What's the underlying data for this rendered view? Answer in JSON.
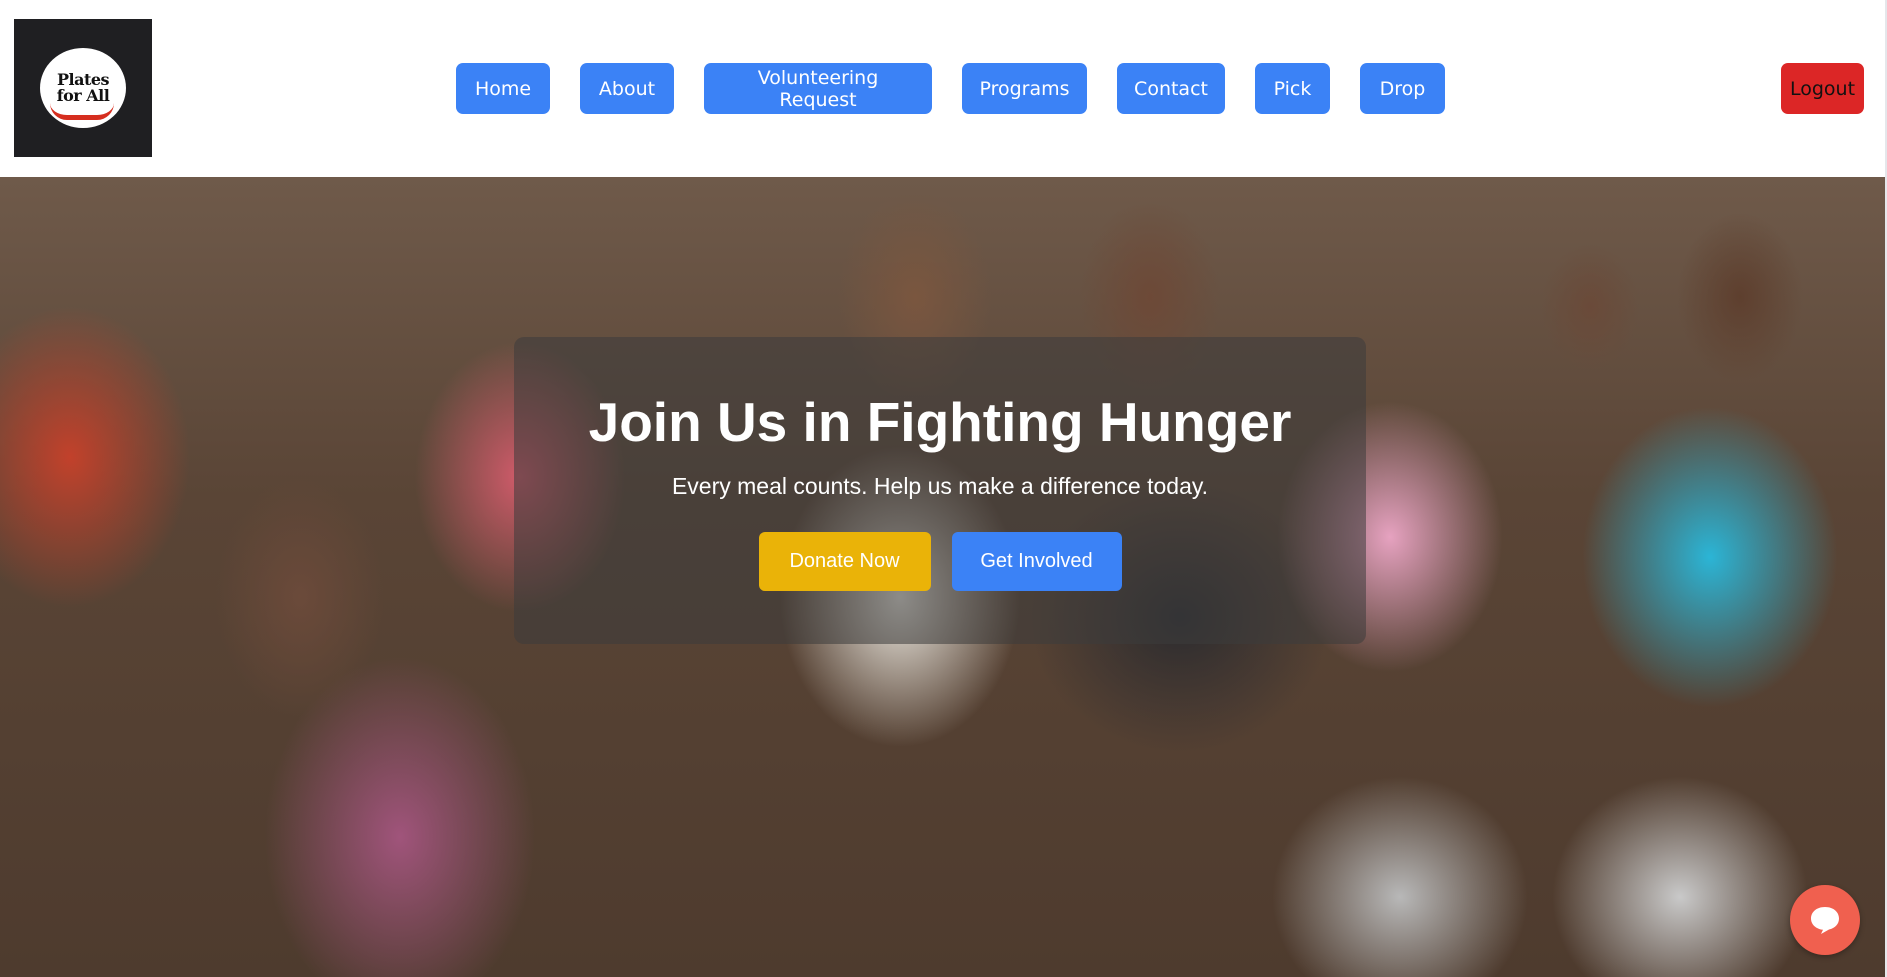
{
  "header": {
    "logo": {
      "line1": "Plates",
      "line2": "for All"
    },
    "nav": [
      {
        "label": "Home"
      },
      {
        "label": "About"
      },
      {
        "label": "Volunteering Request"
      },
      {
        "label": "Programs"
      },
      {
        "label": "Contact"
      },
      {
        "label": "Pick"
      },
      {
        "label": "Drop"
      }
    ],
    "logout_label": "Logout"
  },
  "hero": {
    "title": "Join Us in Fighting Hunger",
    "subtitle": "Every meal counts. Help us make a difference today.",
    "donate_label": "Donate Now",
    "involved_label": "Get Involved"
  },
  "chat": {
    "icon": "chat-bubble-icon"
  },
  "colors": {
    "nav_button": "#3b82f6",
    "logout_button": "#dc2626",
    "donate_button": "#eab308",
    "chat_button": "#f0604f"
  }
}
